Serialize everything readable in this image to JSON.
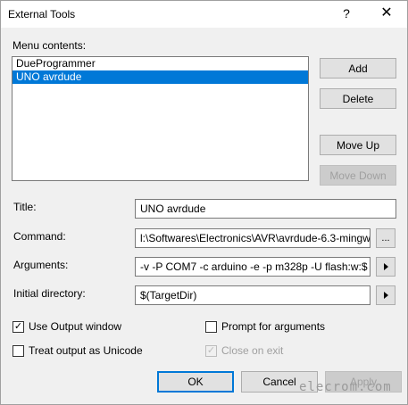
{
  "window": {
    "title": "External Tools",
    "help_label": "?",
    "close_label": "✕"
  },
  "menu_contents": {
    "label": "Menu contents:",
    "items": [
      {
        "label": "DueProgrammer",
        "selected": false
      },
      {
        "label": "UNO avrdude",
        "selected": true
      }
    ]
  },
  "side_buttons": {
    "add": "Add",
    "delete": "Delete",
    "move_up": "Move Up",
    "move_down": "Move Down"
  },
  "fields": {
    "title": {
      "label": "Title:",
      "value": "UNO avrdude"
    },
    "command": {
      "label": "Command:",
      "value": "l:\\Softwares\\Electronics\\AVR\\avrdude-6.3-mingw",
      "browse_label": "..."
    },
    "arguments": {
      "label": "Arguments:",
      "value": "-v -P COM7 -c arduino -e -p m328p -U flash:w:$"
    },
    "initial_directory": {
      "label": "Initial directory:",
      "value": "$(TargetDir)"
    }
  },
  "options": {
    "use_output_window": {
      "label": "Use Output window",
      "checked": true,
      "check_glyph": "✓"
    },
    "prompt_for_arguments": {
      "label": "Prompt for arguments",
      "checked": false
    },
    "treat_output_as_unicode": {
      "label": "Treat output as Unicode",
      "checked": false
    },
    "close_on_exit": {
      "label": "Close on exit",
      "checked": true,
      "disabled": true,
      "check_glyph": "✓"
    }
  },
  "footer": {
    "ok": "OK",
    "cancel": "Cancel",
    "apply": "Apply"
  },
  "watermark": "elecrom.com",
  "colors": {
    "selection": "#0078d7",
    "dialog_bg": "#f0f0f0",
    "button_bg": "#e1e1e1"
  }
}
